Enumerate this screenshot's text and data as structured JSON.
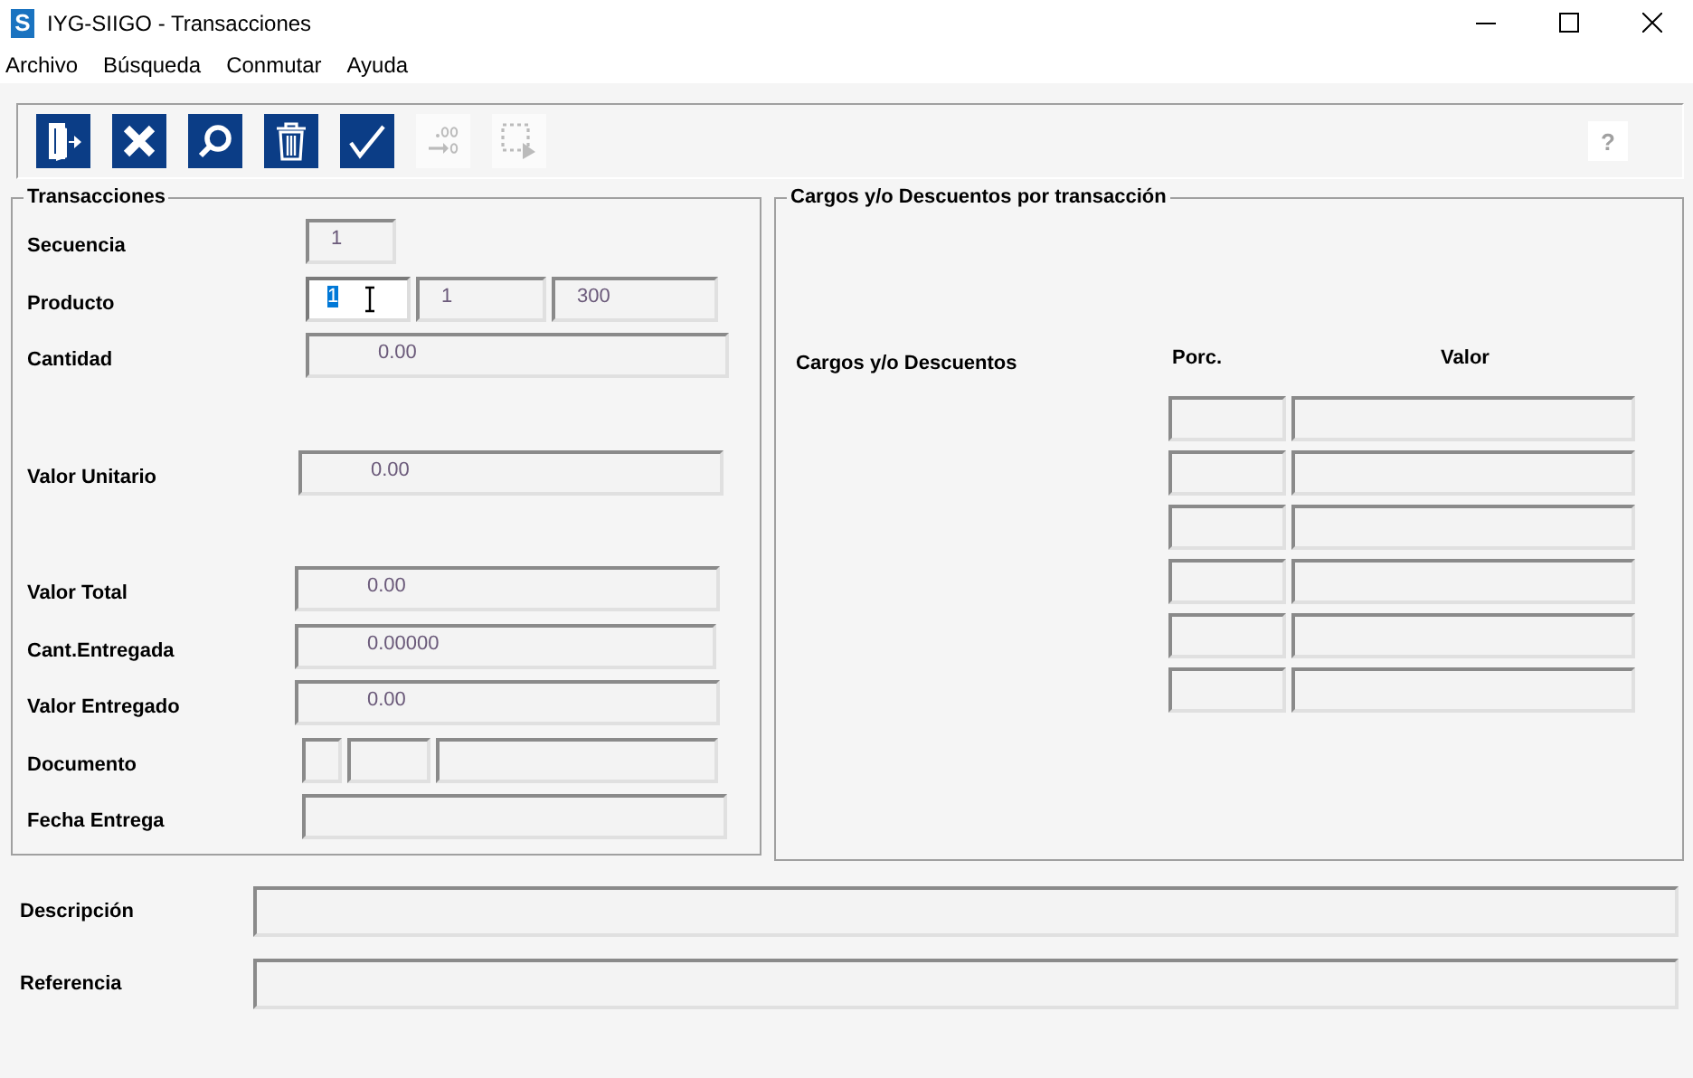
{
  "window": {
    "logo": "S",
    "title": "IYG-SIIGO - Transacciones"
  },
  "menu": [
    "Archivo",
    "Búsqueda",
    "Conmutar",
    "Ayuda"
  ],
  "toolbar": [
    {
      "kind": "exit",
      "disabled": false
    },
    {
      "kind": "cancel",
      "disabled": false
    },
    {
      "kind": "search",
      "disabled": false
    },
    {
      "kind": "delete",
      "disabled": false
    },
    {
      "kind": "accept",
      "disabled": false
    },
    {
      "kind": "decimals",
      "disabled": true
    },
    {
      "kind": "select",
      "disabled": true
    }
  ],
  "help_button": {
    "label": "?",
    "disabled": true
  },
  "transacciones": {
    "title": "Transacciones",
    "rows": [
      {
        "label": "Secuencia",
        "fields": [
          {
            "value": "1",
            "editable": false
          }
        ]
      },
      {
        "label": "Producto",
        "fields": [
          {
            "value": "1",
            "editable": true,
            "focused": true
          },
          {
            "value": "1",
            "editable": false
          },
          {
            "value": "300",
            "editable": false
          }
        ]
      },
      {
        "label": "Cantidad",
        "fields": [
          {
            "value": "0.00",
            "editable": false
          }
        ]
      },
      {
        "label": "Valor Unitario",
        "fields": [
          {
            "value": "0.00",
            "editable": false
          }
        ]
      },
      {
        "label": "Valor Total",
        "fields": [
          {
            "value": "0.00",
            "editable": false
          }
        ]
      },
      {
        "label": "Cant.Entregada",
        "fields": [
          {
            "value": "0.00000",
            "editable": false
          }
        ]
      },
      {
        "label": "Valor Entregado",
        "fields": [
          {
            "value": "0.00",
            "editable": false
          }
        ]
      },
      {
        "label": "Documento",
        "fields": [
          {
            "editable": false
          },
          {
            "editable": false
          },
          {
            "editable": false
          }
        ]
      },
      {
        "label": "Fecha Entrega",
        "fields": [
          {
            "editable": false
          }
        ]
      }
    ]
  },
  "cargos": {
    "title": "Cargos y/o Descuentos por transacción",
    "label": "Cargos y/o Descuentos",
    "columns": [
      "Porc.",
      "Valor"
    ],
    "rows": [
      {
        "editable": false
      },
      {
        "editable": false
      },
      {
        "editable": false
      },
      {
        "editable": false
      },
      {
        "editable": false
      },
      {
        "editable": false
      }
    ]
  },
  "descripcion": {
    "label": "Descripción"
  },
  "referencia": {
    "label": "Referencia"
  }
}
